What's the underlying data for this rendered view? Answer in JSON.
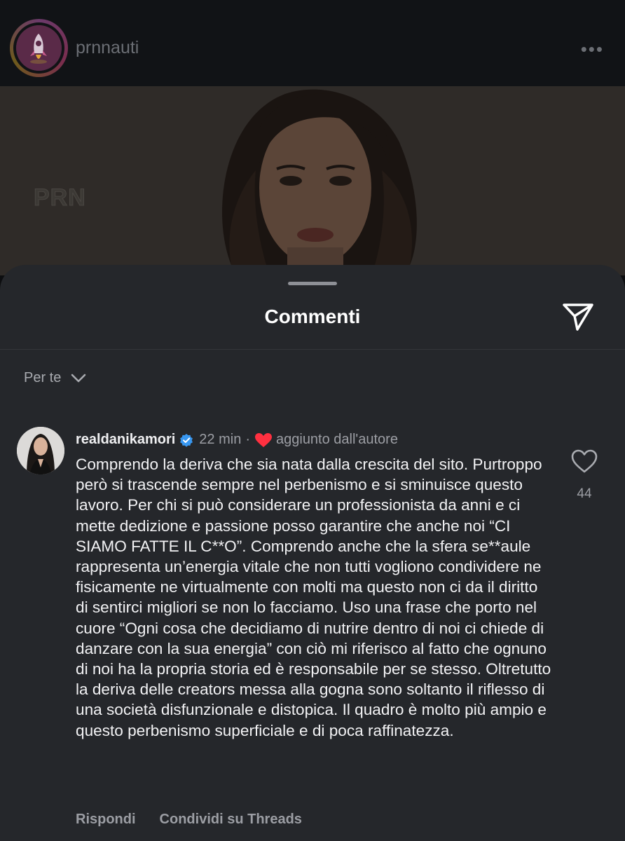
{
  "post": {
    "username": "prnnauti",
    "more_icon": "more-dots-icon",
    "watermark": "PRN"
  },
  "sheet": {
    "title": "Commenti",
    "send_icon": "send-icon",
    "sort_label": "Per te",
    "sort_icon": "chevron-down-icon"
  },
  "comment": {
    "username": "realdanikamori",
    "verified_icon": "verified-badge-icon",
    "time": "22 min",
    "separator": "·",
    "author_liked_icon": "heart-filled-icon",
    "author_liked_label": "aggiunto dall'autore",
    "text": "Comprendo la deriva che sia nata dalla crescita del sito. Purtroppo però si trascende sempre nel perbenismo e si sminuisce questo lavoro. Per chi si può considerare un professionista da anni e ci mette dedizione e passione posso garantire che anche noi “CI SIAMO FATTE IL C**O”. Comprendo anche che la sfera se**aule rappresenta un’energia vitale che non tutti vogliono condividere ne fisicamente ne virtualmente con molti ma questo non ci da il diritto di sentirci migliori se non lo facciamo. Uso una frase che porto nel cuore “Ogni cosa che decidiamo di nutrire dentro di noi ci chiede di danzare con la sua energia” con ciò mi riferisco al fatto che ognuno di noi ha la propria storia ed è responsabile per se stesso. Oltretutto la deriva delle creators messa alla gogna sono soltanto il riflesso di una società disfunzionale e distopica. Il quadro è molto più ampio e questo perbenismo superficiale e di poca raffinatezza.",
    "like_count": "44",
    "reply_label": "Rispondi",
    "share_label": "Condividi su Threads"
  },
  "colors": {
    "sheet_bg": "#25272b",
    "verified": "#3897f0",
    "heart": "#ff3040"
  }
}
